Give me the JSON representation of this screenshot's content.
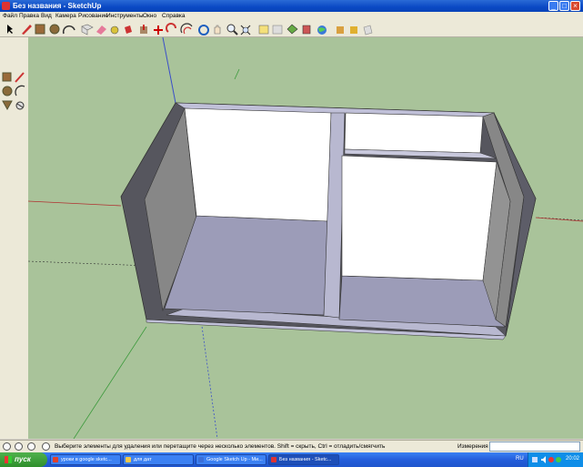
{
  "window": {
    "title": "Без названия - SketchUp"
  },
  "menu": [
    "Файл",
    "Правка",
    "Вид",
    "Камера",
    "Рисование",
    "Инструменты",
    "Окно",
    "Справка"
  ],
  "status": {
    "hint": "Выберите элементы для удаления или перетащите через несколько элементов. Shift = скрыть, Ctrl = отладить/смягчить",
    "measure_label": "Измерения",
    "measure_value": ""
  },
  "taskbar": {
    "start": "пуск",
    "tasks": [
      {
        "label": "уроки в google sketc...",
        "color": "#e0402b"
      },
      {
        "label": "для дат",
        "color": "#f2c84b"
      },
      {
        "label": "Google Sketch Up - Ми...",
        "color": "#3b6fd8"
      },
      {
        "label": "Без названия - Sketc...",
        "color": "#d33"
      }
    ],
    "lang": "RU",
    "clock": "20:02"
  },
  "colors": {
    "viewport": "#a9c39a",
    "titlebar": "#0a49c4",
    "surface_white": "#ffffff",
    "surface_grey": "#8e8e8e",
    "floor": "#9c9cb8"
  }
}
